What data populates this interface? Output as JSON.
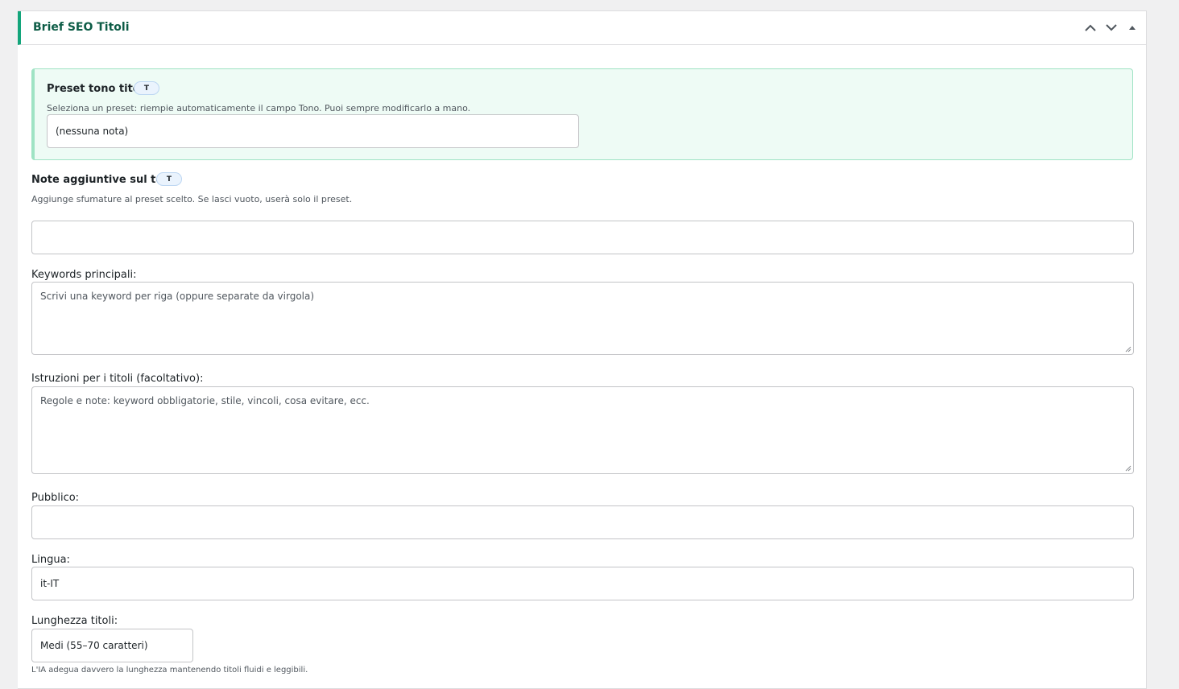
{
  "panel": {
    "title": "Brief SEO Titoli",
    "accent_color": "#13a57b",
    "controls": [
      "chevron-up-icon",
      "chevron-down-icon",
      "caret-up-icon"
    ]
  },
  "preset": {
    "label": "Preset tono titoli",
    "badge": "T",
    "hint": "Seleziona un preset: riempie automaticamente il campo Tono. Puoi sempre modificarlo a mano.",
    "selected": "(nessuna nota)"
  },
  "tone_notes": {
    "label": "Note aggiuntive sul tono",
    "badge": "T",
    "hint": "Aggiunge sfumature al preset scelto. Se lasci vuoto, userà solo il preset.",
    "value": ""
  },
  "keywords": {
    "label": "Keywords principali:",
    "placeholder": "Scrivi una keyword per riga (oppure separate da virgola)"
  },
  "instructions": {
    "label": "Istruzioni per i titoli (facoltativo):",
    "placeholder": "Regole e note: keyword obbligatorie, stile, vincoli, cosa evitare, ecc."
  },
  "audience": {
    "label": "Pubblico:",
    "value": ""
  },
  "language": {
    "label": "Lingua:",
    "value": "it-IT"
  },
  "title_length": {
    "label": "Lunghezza titoli:",
    "selected": "Medi (55–70 caratteri)",
    "hint": "L'IA adegua davvero la lunghezza mantenendo titoli fluidi e leggibili."
  }
}
